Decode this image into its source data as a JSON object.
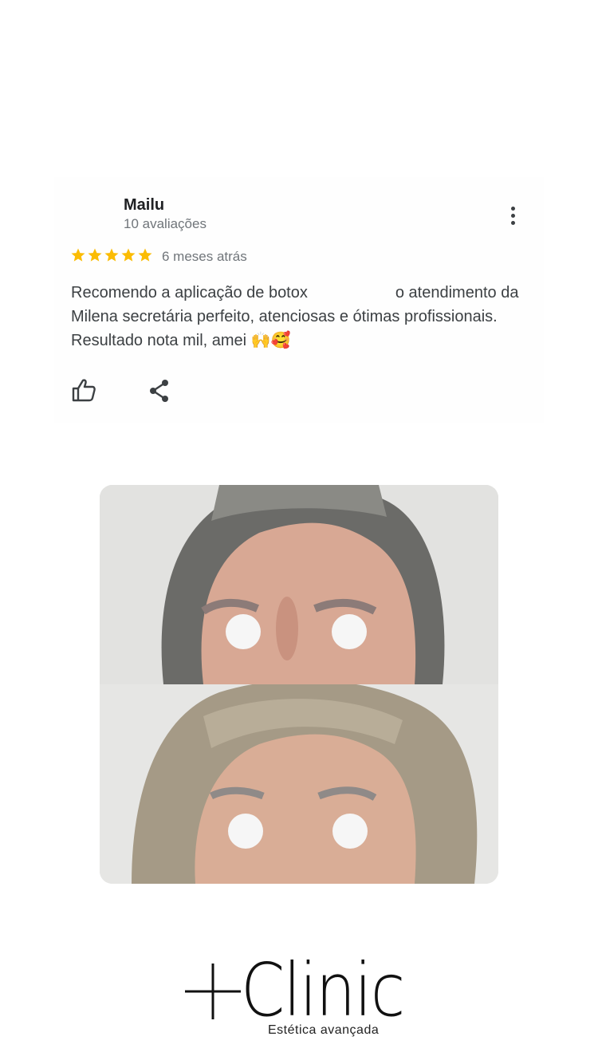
{
  "review": {
    "reviewer_name": "Mailu",
    "reviewer_count": "10 avaliações",
    "rating": 5,
    "rating_max": 5,
    "time_ago": "6 meses atrás",
    "text_part1": "Recomendo a aplicação de botox",
    "text_part2": "o atendimento da Milena secretária perfeito, atenciosas e ótimas profissionais. Resultado nota mil, amei 🙌🥰",
    "star_color": "#fbbc04"
  },
  "actions": {
    "like_icon": "thumbs-up-icon",
    "share_icon": "share-icon",
    "more_icon": "more-vert-icon"
  },
  "brand": {
    "logo_symbol": "+",
    "name": "Clinic",
    "tagline": "Estética avançada"
  }
}
